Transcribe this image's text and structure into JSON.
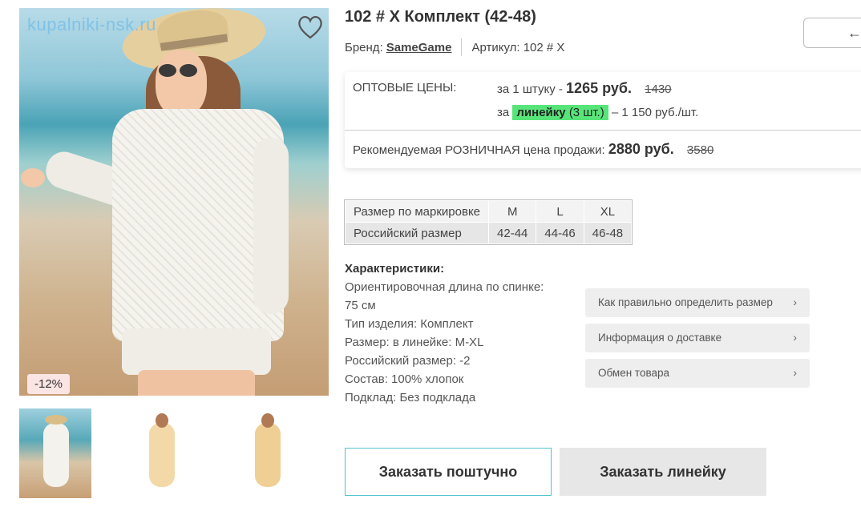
{
  "product": {
    "title": "102 # X Комплект (42-48)",
    "brand_label": "Бренд:",
    "brand_name": "SameGame",
    "article_label": "Артикул:",
    "article_value": "102 # X"
  },
  "gallery": {
    "watermark": "kupalniki-nsk.ru",
    "discount_badge": "-12%",
    "thumbnails": [
      "thumb-1",
      "thumb-2",
      "thumb-3"
    ]
  },
  "prices": {
    "wholesale_label": "ОПТОВЫЕ ЦЕНЫ:",
    "per_piece_prefix": "за 1 штуку -",
    "per_piece_price": "1265 руб.",
    "per_piece_old": "1430",
    "line_prefix": "за",
    "line_word": "линейку",
    "line_count": "(3 шт.)",
    "line_price": "– 1 150 руб./шт.",
    "retail_label": "Рекомендуемая РОЗНИЧНАЯ цена продажи:",
    "retail_price": "2880 руб.",
    "retail_old": "3580"
  },
  "sizes": {
    "row1": [
      "Размер по маркировке",
      "M",
      "L",
      "XL"
    ],
    "row2": [
      "Российский размер",
      "42-44",
      "44-46",
      "46-48"
    ]
  },
  "characteristics": {
    "title": "Характеристики:",
    "lines": [
      "Ориентировочная длина по спинке:",
      "75 см",
      "Тип изделия: Комплект",
      "Размер: в линейке: M-XL",
      "Российский размер: -2",
      "Состав: 100% хлопок",
      "Подклад: Без подклада"
    ]
  },
  "info_buttons": [
    "Как правильно определить размер",
    "Информация о доставке",
    "Обмен товара"
  ],
  "actions": {
    "order_single": "Заказать поштучно",
    "order_line": "Заказать линейку",
    "top_button_arrow": "←"
  },
  "colors": {
    "highlight": "#57e57a",
    "accent_border": "#4fc3d1",
    "badge_bg": "#fbe4e4"
  }
}
